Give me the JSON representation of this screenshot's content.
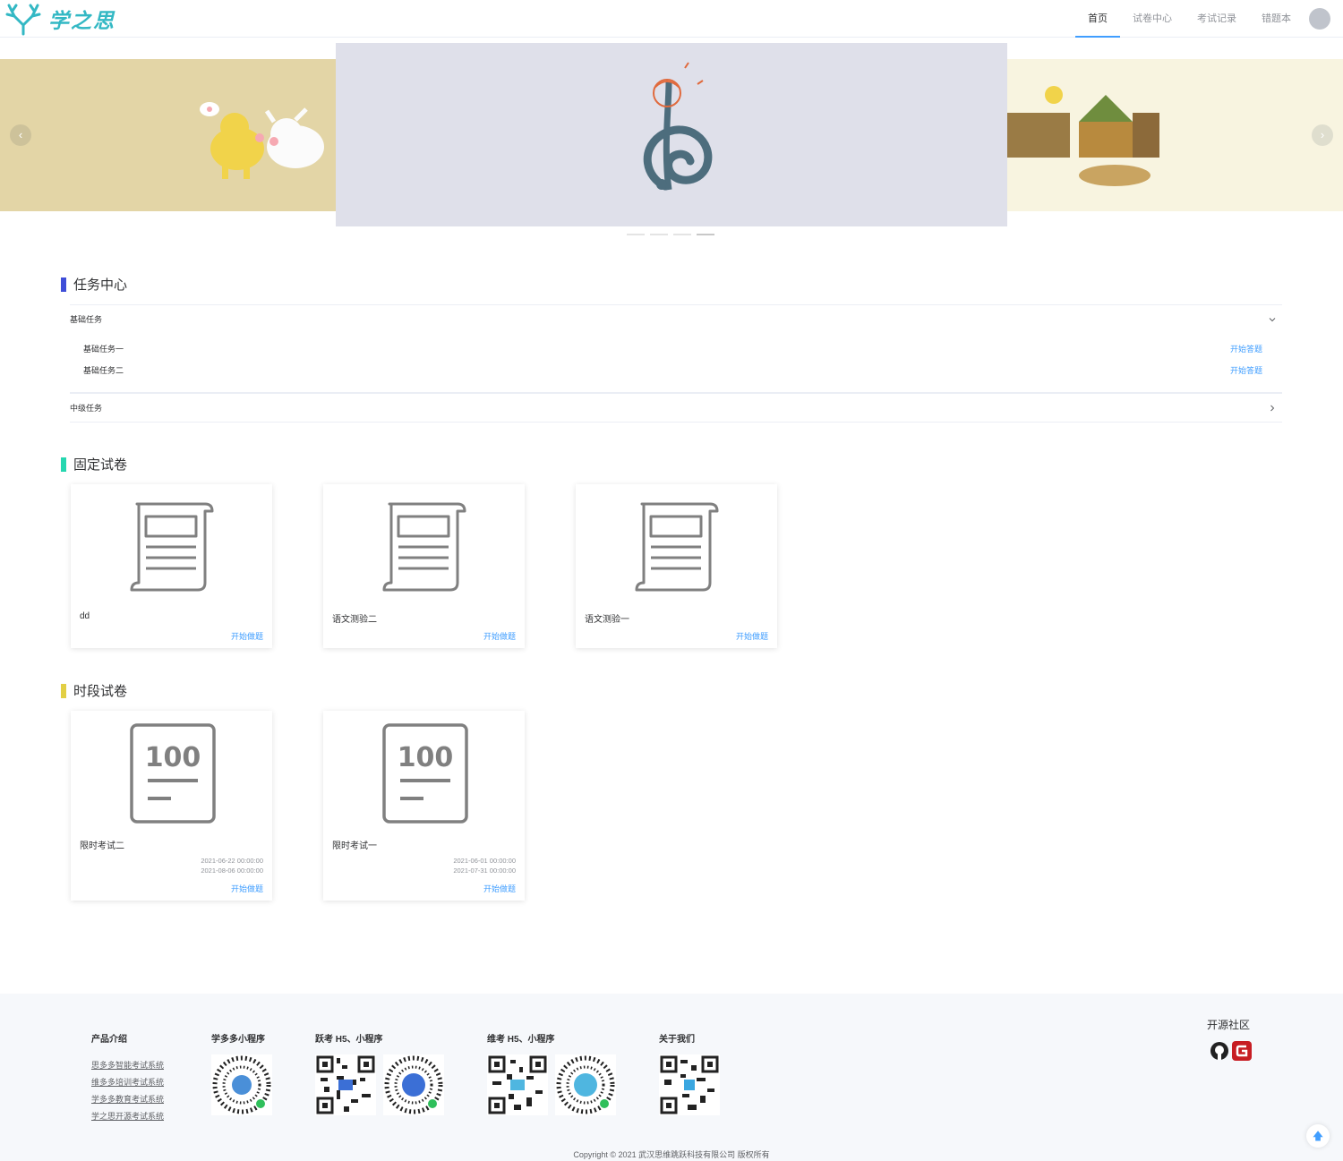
{
  "header": {
    "logo_text": "学之思",
    "nav": [
      "首页",
      "试卷中心",
      "考试记录",
      "错题本"
    ],
    "active_nav": "首页"
  },
  "carousel": {
    "prev_icon": "chevron-left-icon",
    "next_icon": "chevron-right-icon",
    "slide_count": 4,
    "active_slide": 4
  },
  "task_center": {
    "title": "任务中心",
    "groups": [
      {
        "name": "基础任务",
        "expanded": true,
        "items": [
          {
            "name": "基础任务一",
            "action": "开始答题"
          },
          {
            "name": "基础任务二",
            "action": "开始答题"
          }
        ]
      },
      {
        "name": "中级任务",
        "expanded": false,
        "items": []
      }
    ]
  },
  "fixed_papers": {
    "title": "固定试卷",
    "cards": [
      {
        "name": "dd",
        "action": "开始做题"
      },
      {
        "name": "语文测验二",
        "action": "开始做题"
      },
      {
        "name": "语文测验一",
        "action": "开始做题"
      }
    ]
  },
  "timed_papers": {
    "title": "时段试卷",
    "score_badge": "100",
    "cards": [
      {
        "name": "限时考试二",
        "start": "2021-06-22 00:00:00",
        "end": "2021-08-06 00:00:00",
        "action": "开始做题"
      },
      {
        "name": "限时考试一",
        "start": "2021-06-01 00:00:00",
        "end": "2021-07-31 00:00:00",
        "action": "开始做题"
      }
    ]
  },
  "footer": {
    "product_title": "产品介绍",
    "product_links": [
      "思多多智能考试系统",
      "维多多培训考试系统",
      "学多多教育考试系统",
      "学之思开源考试系统"
    ],
    "xueduoduo_title": "学多多小程序",
    "yuekao_title": "跃考 H5、小程序",
    "weikao_title": "维考 H5、小程序",
    "about_title": "关于我们",
    "community_title": "开源社区",
    "copyright": "Copyright © 2021 武汉思维跳跃科技有限公司 版权所有"
  },
  "colors": {
    "accent": "#409eff",
    "task_bar": "#3f4ed8",
    "fixed_bar": "#26d7b0",
    "timed_bar": "#e2cf44"
  }
}
